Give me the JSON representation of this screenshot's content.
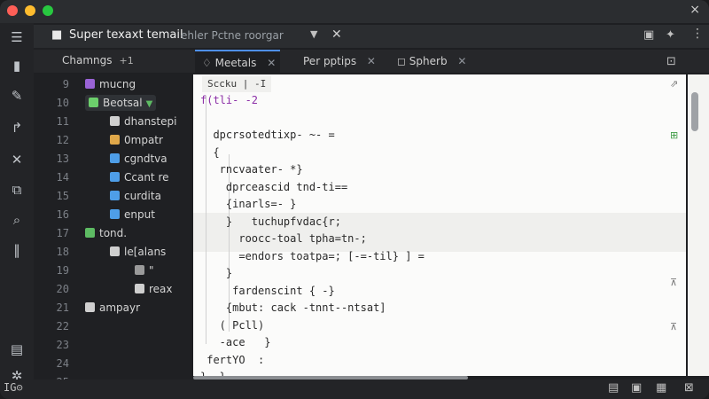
{
  "window": {
    "title": "Super texaxt temail",
    "subtitle": "ehler Pctne roorgar",
    "close_label": "×"
  },
  "activity_bar": {
    "icons": [
      "explorer-icon",
      "chart-icon",
      "pen-icon",
      "share-arrow-icon",
      "debug-icon",
      "extensions-icon",
      "search-icon",
      "columns-icon",
      "layers-icon",
      "settings-icon"
    ],
    "bottom_label": "IG⊝"
  },
  "sidebar": {
    "title": "Chamngs",
    "badge": "+1",
    "rows": [
      {
        "line": "9",
        "label": "mucng",
        "indent": 0,
        "color": "#9a63d6"
      },
      {
        "line": "10",
        "label": "Beotsal",
        "indent": 0,
        "color": "#6ccf6c",
        "selected": true
      },
      {
        "line": "11",
        "label": "dhanstepi",
        "indent": 1,
        "color": "#cfcfcf"
      },
      {
        "line": "12",
        "label": "0mpatr",
        "indent": 1,
        "color": "#e0a84a"
      },
      {
        "line": "13",
        "label": "cgndtva",
        "indent": 1,
        "color": "#4e9ee8"
      },
      {
        "line": "14",
        "label": "Ccant re",
        "indent": 1,
        "color": "#4e9ee8"
      },
      {
        "line": "15",
        "label": "curdita",
        "indent": 1,
        "color": "#4e9ee8"
      },
      {
        "line": "16",
        "label": "enput",
        "indent": 1,
        "color": "#4e9ee8"
      },
      {
        "line": "17",
        "label": "tond.",
        "indent": 0,
        "color": "#5dbb63"
      },
      {
        "line": "18",
        "label": "le[alans",
        "indent": 1,
        "color": "#cfcfcf"
      },
      {
        "line": "19",
        "label": "\"",
        "indent": 2,
        "color": "#9a9a9a"
      },
      {
        "line": "20",
        "label": "reax",
        "indent": 2,
        "color": "#cfcfcf"
      },
      {
        "line": "21",
        "label": "ampayr",
        "indent": 0,
        "color": "#cfcfcf"
      },
      {
        "line": "22",
        "label": "",
        "indent": 0,
        "color": "#cfcfcf"
      },
      {
        "line": "23",
        "label": "",
        "indent": 0,
        "color": "#cfcfcf"
      },
      {
        "line": "24",
        "label": "",
        "indent": 0,
        "color": "#cfcfcf"
      },
      {
        "line": "25",
        "label": "",
        "indent": 0,
        "color": "#cfcfcf"
      }
    ]
  },
  "tabs": [
    {
      "label": "Meetals",
      "active": true
    },
    {
      "label": "Per pptips",
      "active": false
    },
    {
      "label": "Spherb",
      "active": false
    }
  ],
  "editor": {
    "breadcrumb": "Sccku | -I",
    "lines": [
      "f(tli- -2",
      "",
      "  dpcrsotedtixp- ~- =",
      "  {",
      "   rncvaater- *}",
      "    dprceascid tnd-ti==",
      "    {inarls=- }",
      "    }   tuchupfvdac{r;",
      "      roocc-toal tpha=tn-;",
      "      =endors toatpa=; [-=-til} ] =",
      "    }",
      "     fardenscint { -}",
      "    {mbut: cack -tnnt--ntsat]",
      "   ( Pcll)",
      "   -ace   }",
      " fertYO  :",
      "}- }"
    ]
  },
  "colors": {
    "accent": "#4e8fe8",
    "editor_bg": "#fbfbfa",
    "sidebar_bg": "#1f2023"
  }
}
